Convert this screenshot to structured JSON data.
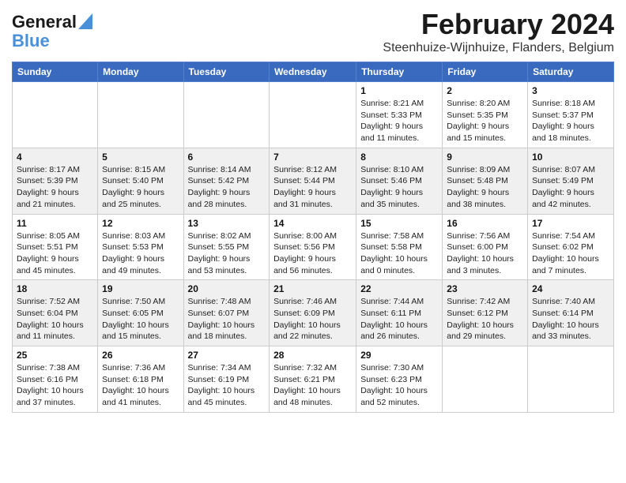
{
  "header": {
    "logo_line1": "General",
    "logo_line2": "Blue",
    "title": "February 2024",
    "subtitle": "Steenhuize-Wijnhuize, Flanders, Belgium"
  },
  "days_of_week": [
    "Sunday",
    "Monday",
    "Tuesday",
    "Wednesday",
    "Thursday",
    "Friday",
    "Saturday"
  ],
  "weeks": [
    {
      "days": [
        {
          "number": "",
          "info": ""
        },
        {
          "number": "",
          "info": ""
        },
        {
          "number": "",
          "info": ""
        },
        {
          "number": "",
          "info": ""
        },
        {
          "number": "1",
          "info": "Sunrise: 8:21 AM\nSunset: 5:33 PM\nDaylight: 9 hours\nand 11 minutes."
        },
        {
          "number": "2",
          "info": "Sunrise: 8:20 AM\nSunset: 5:35 PM\nDaylight: 9 hours\nand 15 minutes."
        },
        {
          "number": "3",
          "info": "Sunrise: 8:18 AM\nSunset: 5:37 PM\nDaylight: 9 hours\nand 18 minutes."
        }
      ]
    },
    {
      "days": [
        {
          "number": "4",
          "info": "Sunrise: 8:17 AM\nSunset: 5:39 PM\nDaylight: 9 hours\nand 21 minutes."
        },
        {
          "number": "5",
          "info": "Sunrise: 8:15 AM\nSunset: 5:40 PM\nDaylight: 9 hours\nand 25 minutes."
        },
        {
          "number": "6",
          "info": "Sunrise: 8:14 AM\nSunset: 5:42 PM\nDaylight: 9 hours\nand 28 minutes."
        },
        {
          "number": "7",
          "info": "Sunrise: 8:12 AM\nSunset: 5:44 PM\nDaylight: 9 hours\nand 31 minutes."
        },
        {
          "number": "8",
          "info": "Sunrise: 8:10 AM\nSunset: 5:46 PM\nDaylight: 9 hours\nand 35 minutes."
        },
        {
          "number": "9",
          "info": "Sunrise: 8:09 AM\nSunset: 5:48 PM\nDaylight: 9 hours\nand 38 minutes."
        },
        {
          "number": "10",
          "info": "Sunrise: 8:07 AM\nSunset: 5:49 PM\nDaylight: 9 hours\nand 42 minutes."
        }
      ]
    },
    {
      "days": [
        {
          "number": "11",
          "info": "Sunrise: 8:05 AM\nSunset: 5:51 PM\nDaylight: 9 hours\nand 45 minutes."
        },
        {
          "number": "12",
          "info": "Sunrise: 8:03 AM\nSunset: 5:53 PM\nDaylight: 9 hours\nand 49 minutes."
        },
        {
          "number": "13",
          "info": "Sunrise: 8:02 AM\nSunset: 5:55 PM\nDaylight: 9 hours\nand 53 minutes."
        },
        {
          "number": "14",
          "info": "Sunrise: 8:00 AM\nSunset: 5:56 PM\nDaylight: 9 hours\nand 56 minutes."
        },
        {
          "number": "15",
          "info": "Sunrise: 7:58 AM\nSunset: 5:58 PM\nDaylight: 10 hours\nand 0 minutes."
        },
        {
          "number": "16",
          "info": "Sunrise: 7:56 AM\nSunset: 6:00 PM\nDaylight: 10 hours\nand 3 minutes."
        },
        {
          "number": "17",
          "info": "Sunrise: 7:54 AM\nSunset: 6:02 PM\nDaylight: 10 hours\nand 7 minutes."
        }
      ]
    },
    {
      "days": [
        {
          "number": "18",
          "info": "Sunrise: 7:52 AM\nSunset: 6:04 PM\nDaylight: 10 hours\nand 11 minutes."
        },
        {
          "number": "19",
          "info": "Sunrise: 7:50 AM\nSunset: 6:05 PM\nDaylight: 10 hours\nand 15 minutes."
        },
        {
          "number": "20",
          "info": "Sunrise: 7:48 AM\nSunset: 6:07 PM\nDaylight: 10 hours\nand 18 minutes."
        },
        {
          "number": "21",
          "info": "Sunrise: 7:46 AM\nSunset: 6:09 PM\nDaylight: 10 hours\nand 22 minutes."
        },
        {
          "number": "22",
          "info": "Sunrise: 7:44 AM\nSunset: 6:11 PM\nDaylight: 10 hours\nand 26 minutes."
        },
        {
          "number": "23",
          "info": "Sunrise: 7:42 AM\nSunset: 6:12 PM\nDaylight: 10 hours\nand 29 minutes."
        },
        {
          "number": "24",
          "info": "Sunrise: 7:40 AM\nSunset: 6:14 PM\nDaylight: 10 hours\nand 33 minutes."
        }
      ]
    },
    {
      "days": [
        {
          "number": "25",
          "info": "Sunrise: 7:38 AM\nSunset: 6:16 PM\nDaylight: 10 hours\nand 37 minutes."
        },
        {
          "number": "26",
          "info": "Sunrise: 7:36 AM\nSunset: 6:18 PM\nDaylight: 10 hours\nand 41 minutes."
        },
        {
          "number": "27",
          "info": "Sunrise: 7:34 AM\nSunset: 6:19 PM\nDaylight: 10 hours\nand 45 minutes."
        },
        {
          "number": "28",
          "info": "Sunrise: 7:32 AM\nSunset: 6:21 PM\nDaylight: 10 hours\nand 48 minutes."
        },
        {
          "number": "29",
          "info": "Sunrise: 7:30 AM\nSunset: 6:23 PM\nDaylight: 10 hours\nand 52 minutes."
        },
        {
          "number": "",
          "info": ""
        },
        {
          "number": "",
          "info": ""
        }
      ]
    }
  ]
}
